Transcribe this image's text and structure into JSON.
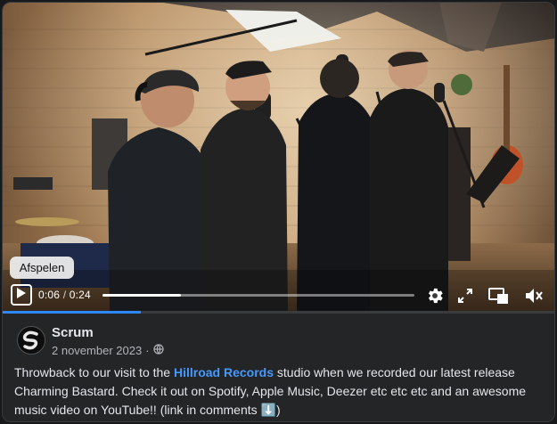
{
  "video": {
    "tooltip": "Afspelen",
    "current_time": "0:06",
    "separator": " / ",
    "duration": "0:24",
    "progress_fraction": 0.25,
    "icons": [
      "play-icon",
      "settings-gear-icon",
      "fullscreen-icon",
      "picture-in-picture-icon",
      "mute-icon"
    ]
  },
  "post": {
    "author": "Scrum",
    "date": "2 november 2023",
    "date_separator": "·",
    "privacy_icon": "globe-icon",
    "text_before_link": "Throwback to our visit to the ",
    "link_text": "Hillroad Records",
    "text_after_link": " studio when we recorded our latest release Charming Bastard. Check it out on Spotify, Apple Music, Deezer etc etc etc and an awesome music video on YouTube!! (link in comments ",
    "emoji": "⬇️",
    "text_end": ")"
  },
  "colors": {
    "accent": "#2d88ff",
    "link": "#4599ff",
    "background": "#242526",
    "text": "#e4e6eb",
    "muted": "#b0b3b8"
  }
}
